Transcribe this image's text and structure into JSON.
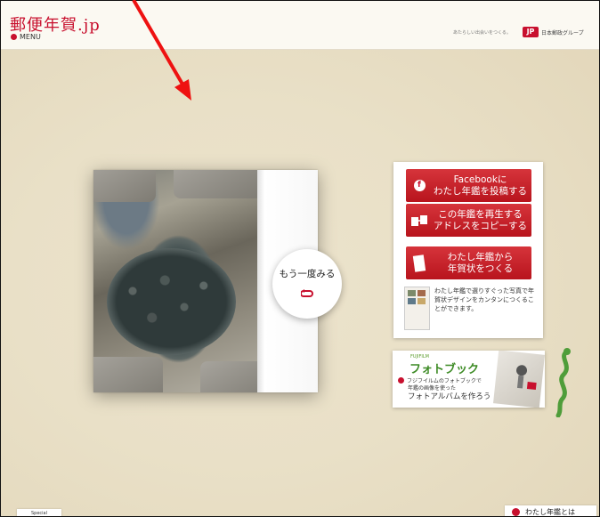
{
  "header": {
    "logo": "郵便年賀.jp",
    "menu_label": "MENU",
    "tagline": "あたらしい出会いをつくる。",
    "jp_mark": "JP",
    "group_name": "日本郵政グループ"
  },
  "book": {
    "again_label": "もう一度みる"
  },
  "panel": {
    "buttons": [
      {
        "icon": "facebook-icon",
        "badge": "f",
        "line1": "Facebookに",
        "line2": "わたし年鑑を投稿する"
      },
      {
        "icon": "copy-address-icon",
        "line1": "この年鑑を再生する",
        "line2": "アドレスをコピーする"
      },
      {
        "icon": "postcard-icon",
        "line1": "わたし年鑑から",
        "line2": "年賀状をつくる"
      }
    ],
    "description": "わたし年鑑で選りすぐった写真で年賀状デザインをカンタンにつくることができます。"
  },
  "banner": {
    "small_text": "FUJIFILM",
    "title": "フォトブック",
    "line1": "フジフイルムのフォトブックで",
    "line2": "年鑑の画像を使った",
    "line3": "フォトアルバムを作ろう"
  },
  "footer": {
    "left_label": "Special",
    "right_label": "わたし年鑑とは"
  },
  "colors": {
    "brand_red": "#c8102e",
    "banner_green": "#3d8b25",
    "background": "#e9e0c7"
  }
}
